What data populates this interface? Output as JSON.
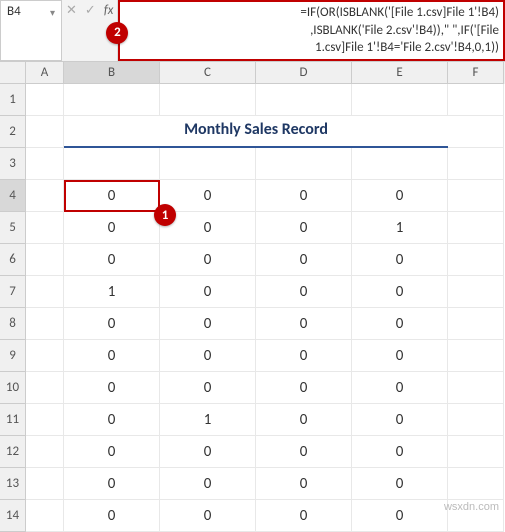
{
  "namebox": "B4",
  "formula_line1": "=IF(OR(ISBLANK('[File 1.csv]File 1'!B4)",
  "formula_line2": ",ISBLANK('File 2.csv'!B4)),\"  \",IF('[File",
  "formula_line3": "1.csv]File 1'!B4='File 2.csv'!B4,0,1))",
  "callouts": {
    "c1": "1",
    "c2": "2"
  },
  "cols": {
    "A": "A",
    "B": "B",
    "C": "C",
    "D": "D",
    "E": "E",
    "F": "F"
  },
  "rows": {
    "r1": "1",
    "r2": "2",
    "r3": "3",
    "r4": "4",
    "r5": "5",
    "r6": "6",
    "r7": "7",
    "r8": "8",
    "r9": "9",
    "r10": "10",
    "r11": "11",
    "r12": "12",
    "r13": "13",
    "r14": "14"
  },
  "title": "Monthly Sales Record",
  "data": {
    "r4": {
      "B": "0",
      "C": "0",
      "D": "0",
      "E": "0"
    },
    "r5": {
      "B": "0",
      "C": "0",
      "D": "0",
      "E": "1"
    },
    "r6": {
      "B": "0",
      "C": "0",
      "D": "0",
      "E": "0"
    },
    "r7": {
      "B": "1",
      "C": "0",
      "D": "0",
      "E": "0"
    },
    "r8": {
      "B": "0",
      "C": "0",
      "D": "0",
      "E": "0"
    },
    "r9": {
      "B": "0",
      "C": "0",
      "D": "0",
      "E": "0"
    },
    "r10": {
      "B": "0",
      "C": "0",
      "D": "0",
      "E": "0"
    },
    "r11": {
      "B": "0",
      "C": "1",
      "D": "0",
      "E": "0"
    },
    "r12": {
      "B": "0",
      "C": "0",
      "D": "0",
      "E": "0"
    },
    "r13": {
      "B": "0",
      "C": "0",
      "D": "0",
      "E": "0"
    },
    "r14": {
      "B": "0",
      "C": "0",
      "D": "0",
      "E": "0"
    }
  },
  "fx_controls": {
    "cancel": "✕",
    "enter": "✓",
    "fx": "fx"
  },
  "watermark": "wsxdn.com"
}
